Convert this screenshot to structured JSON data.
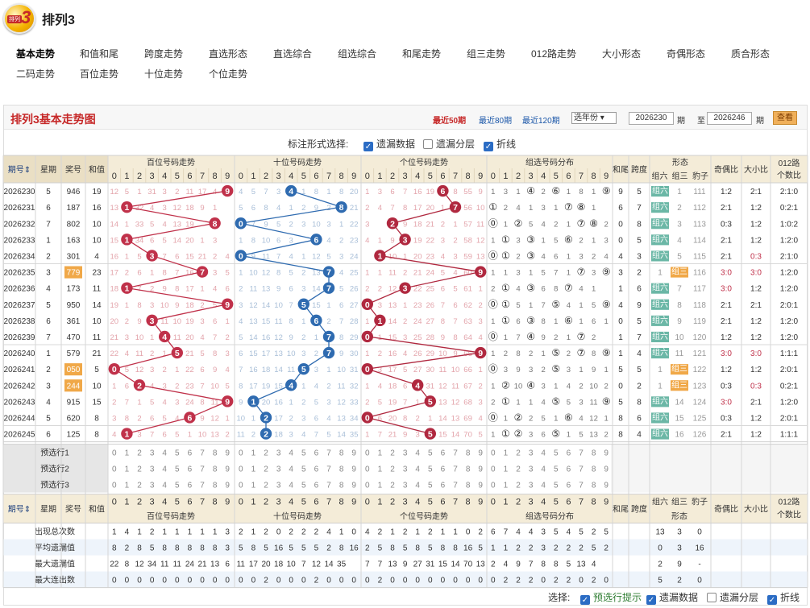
{
  "app": {
    "logo_text": "排列",
    "logo_num": "3",
    "title": "排列3"
  },
  "nav": [
    "基本走势",
    "和值和尾",
    "跨度走势",
    "直选形态",
    "直选综合",
    "组选综合",
    "和尾走势",
    "组三走势",
    "012路走势",
    "大小形态",
    "奇偶形态",
    "质合形态",
    "二码走势",
    "百位走势",
    "十位走势",
    "个位走势"
  ],
  "nav_active": 0,
  "panel": {
    "title": "排列3基本走势图",
    "recent50": "最近50期",
    "recent80": "最近80期",
    "recent120": "最近120期",
    "year_select": "选年份",
    "from": "2026230",
    "qi": "期",
    "to_label": "至",
    "to": "2026246",
    "qi2": "期",
    "view": "查看"
  },
  "options": {
    "label": "标注形式选择:",
    "o1": "遗漏数据",
    "o2": "遗漏分层",
    "o3": "折线"
  },
  "headers": {
    "issue": "期号",
    "week": "星期",
    "prize": "奖号",
    "sum": "和值",
    "g1": "百位号码走势",
    "g2": "十位号码走势",
    "g3": "个位号码走势",
    "g4": "组选号码分布",
    "hw": "和尾",
    "kd": "跨度",
    "xt": "形态",
    "z6": "组六",
    "z3": "组三",
    "bz": "豹子",
    "jo": "奇偶比",
    "dx": "大小比",
    "l012a": "012路",
    "l012b": "个数比"
  },
  "rows": [
    {
      "issue": "2026230",
      "week": "5",
      "prize": "946",
      "sum": "19",
      "hw": "9",
      "kd": "5",
      "form": "组六",
      "bz": "111",
      "jo": "1:2",
      "dx": "2:1",
      "l012": "2:1:0"
    },
    {
      "issue": "2026231",
      "week": "6",
      "prize": "187",
      "sum": "16",
      "hw": "6",
      "kd": "7",
      "form": "组六",
      "bz": "112",
      "jo": "2:1",
      "dx": "1:2",
      "l012": "0:2:1"
    },
    {
      "issue": "2026232",
      "week": "7",
      "prize": "802",
      "sum": "10",
      "hw": "0",
      "kd": "8",
      "form": "组六",
      "bz": "113",
      "jo": "0:3",
      "dx": "1:2",
      "l012": "1:0:2"
    },
    {
      "issue": "2026233",
      "week": "1",
      "prize": "163",
      "sum": "10",
      "hw": "0",
      "kd": "5",
      "form": "组六",
      "bz": "114",
      "jo": "2:1",
      "dx": "1:2",
      "l012": "1:2:0"
    },
    {
      "issue": "2026234",
      "week": "2",
      "prize": "301",
      "sum": "4",
      "hw": "4",
      "kd": "3",
      "form": "组六",
      "bz": "115",
      "jo": "2:1",
      "dx": "0:3",
      "l012": "2:1:0"
    },
    {
      "issue": "2026235",
      "week": "3",
      "prize": "779",
      "sum": "23",
      "hw": "3",
      "kd": "2",
      "form": "组三",
      "bz": "116",
      "jo": "3:0",
      "dx": "3:0",
      "l012": "1:2:0"
    },
    {
      "issue": "2026236",
      "week": "4",
      "prize": "173",
      "sum": "11",
      "hw": "1",
      "kd": "6",
      "form": "组六",
      "bz": "117",
      "jo": "3:0",
      "dx": "1:2",
      "l012": "1:2:0"
    },
    {
      "issue": "2026237",
      "week": "5",
      "prize": "950",
      "sum": "14",
      "hw": "4",
      "kd": "9",
      "form": "组六",
      "bz": "118",
      "jo": "2:1",
      "dx": "2:1",
      "l012": "2:0:1"
    },
    {
      "issue": "2026238",
      "week": "6",
      "prize": "361",
      "sum": "10",
      "hw": "0",
      "kd": "5",
      "form": "组六",
      "bz": "119",
      "jo": "2:1",
      "dx": "1:2",
      "l012": "1:2:0"
    },
    {
      "issue": "2026239",
      "week": "7",
      "prize": "470",
      "sum": "11",
      "hw": "1",
      "kd": "7",
      "form": "组六",
      "bz": "120",
      "jo": "1:2",
      "dx": "1:2",
      "l012": "1:2:0"
    },
    {
      "issue": "2026240",
      "week": "1",
      "prize": "579",
      "sum": "21",
      "hw": "1",
      "kd": "4",
      "form": "组六",
      "bz": "121",
      "jo": "3:0",
      "dx": "3:0",
      "l012": "1:1:1"
    },
    {
      "issue": "2026241",
      "week": "2",
      "prize": "050",
      "sum": "5",
      "hw": "5",
      "kd": "5",
      "form": "组三",
      "bz": "122",
      "jo": "1:2",
      "dx": "1:2",
      "l012": "2:0:1"
    },
    {
      "issue": "2026242",
      "week": "3",
      "prize": "244",
      "sum": "10",
      "hw": "0",
      "kd": "2",
      "form": "组三",
      "bz": "123",
      "jo": "0:3",
      "dx": "0:3",
      "l012": "0:2:1"
    },
    {
      "issue": "2026243",
      "week": "4",
      "prize": "915",
      "sum": "15",
      "hw": "5",
      "kd": "8",
      "form": "组六",
      "bz": "124",
      "jo": "3:0",
      "dx": "2:1",
      "l012": "1:2:0"
    },
    {
      "issue": "2026244",
      "week": "5",
      "prize": "620",
      "sum": "8",
      "hw": "8",
      "kd": "6",
      "form": "组六",
      "bz": "125",
      "jo": "0:3",
      "dx": "1:2",
      "l012": "2:0:1"
    },
    {
      "issue": "2026245",
      "week": "6",
      "prize": "125",
      "sum": "8",
      "hw": "8",
      "kd": "4",
      "form": "组六",
      "bz": "126",
      "jo": "2:1",
      "dx": "1:2",
      "l012": "1:1:1"
    }
  ],
  "miss": {
    "b": [
      [
        12,
        5,
        1,
        31,
        3,
        2,
        11,
        17,
        4,
        null
      ],
      [
        13,
        null,
        32,
        4,
        3,
        12,
        18,
        9,
        1,
        null
      ],
      [
        14,
        1,
        33,
        5,
        4,
        13,
        19,
        null,
        2,
        null
      ],
      [
        15,
        null,
        34,
        6,
        5,
        14,
        20,
        1,
        3,
        null
      ],
      [
        16,
        1,
        5,
        null,
        7,
        6,
        15,
        21,
        2,
        4
      ],
      [
        17,
        2,
        6,
        1,
        8,
        7,
        16,
        null,
        3,
        5
      ],
      [
        18,
        null,
        7,
        2,
        9,
        8,
        17,
        1,
        4,
        6
      ],
      [
        19,
        1,
        8,
        3,
        10,
        9,
        18,
        2,
        5,
        null
      ],
      [
        20,
        2,
        9,
        null,
        11,
        10,
        19,
        3,
        6,
        1
      ],
      [
        21,
        3,
        10,
        1,
        null,
        11,
        20,
        4,
        7,
        2
      ],
      [
        22,
        4,
        11,
        2,
        1,
        null,
        21,
        5,
        8,
        3
      ],
      [
        null,
        5,
        12,
        3,
        2,
        1,
        22,
        6,
        9,
        4
      ],
      [
        1,
        6,
        null,
        4,
        3,
        2,
        23,
        7,
        10,
        5
      ],
      [
        2,
        7,
        1,
        5,
        4,
        3,
        24,
        8,
        11,
        null
      ],
      [
        3,
        8,
        2,
        6,
        5,
        4,
        null,
        9,
        12,
        1
      ],
      [
        4,
        null,
        3,
        7,
        6,
        5,
        1,
        10,
        13,
        2
      ]
    ],
    "s": [
      [
        4,
        5,
        7,
        3,
        null,
        1,
        8,
        1,
        8,
        20
      ],
      [
        5,
        6,
        8,
        4,
        1,
        2,
        9,
        2,
        null,
        21
      ],
      [
        null,
        7,
        9,
        5,
        2,
        3,
        10,
        3,
        1,
        22
      ],
      [
        1,
        8,
        10,
        6,
        3,
        null,
        11,
        4,
        2,
        23
      ],
      [
        null,
        9,
        11,
        7,
        4,
        1,
        12,
        5,
        3,
        24
      ],
      [
        1,
        10,
        12,
        8,
        5,
        2,
        13,
        null,
        4,
        25
      ],
      [
        2,
        11,
        13,
        9,
        6,
        3,
        14,
        null,
        5,
        26
      ],
      [
        3,
        12,
        14,
        10,
        7,
        null,
        15,
        1,
        6,
        27
      ],
      [
        4,
        13,
        15,
        11,
        8,
        1,
        null,
        2,
        7,
        28
      ],
      [
        5,
        14,
        16,
        12,
        9,
        2,
        1,
        null,
        8,
        29
      ],
      [
        6,
        15,
        17,
        13,
        10,
        3,
        2,
        null,
        9,
        30
      ],
      [
        7,
        16,
        18,
        14,
        11,
        null,
        3,
        1,
        10,
        31
      ],
      [
        8,
        17,
        19,
        15,
        null,
        1,
        4,
        2,
        11,
        32
      ],
      [
        9,
        null,
        20,
        16,
        1,
        2,
        5,
        3,
        12,
        33
      ],
      [
        10,
        1,
        null,
        17,
        2,
        3,
        6,
        4,
        13,
        34
      ],
      [
        11,
        2,
        null,
        18,
        3,
        4,
        7,
        5,
        14,
        35
      ]
    ],
    "g": [
      [
        1,
        3,
        6,
        7,
        16,
        19,
        null,
        8,
        55,
        9
      ],
      [
        2,
        4,
        7,
        8,
        17,
        20,
        1,
        null,
        56,
        10
      ],
      [
        3,
        null,
        8,
        9,
        18,
        21,
        2,
        1,
        57,
        11
      ],
      [
        4,
        1,
        9,
        null,
        19,
        22,
        3,
        2,
        58,
        12
      ],
      [
        null,
        null,
        10,
        1,
        20,
        23,
        4,
        3,
        59,
        13
      ],
      [
        1,
        1,
        11,
        2,
        21,
        24,
        5,
        4,
        60,
        null
      ],
      [
        2,
        2,
        12,
        null,
        22,
        25,
        6,
        5,
        61,
        1
      ],
      [
        null,
        3,
        13,
        1,
        23,
        26,
        7,
        6,
        62,
        2
      ],
      [
        1,
        null,
        14,
        2,
        24,
        27,
        8,
        7,
        63,
        3
      ],
      [
        null,
        1,
        15,
        3,
        25,
        28,
        9,
        8,
        64,
        4
      ],
      [
        1,
        2,
        16,
        4,
        26,
        29,
        10,
        9,
        65,
        null
      ],
      [
        null,
        3,
        17,
        5,
        27,
        30,
        11,
        10,
        66,
        1
      ],
      [
        1,
        4,
        18,
        6,
        null,
        31,
        12,
        11,
        67,
        2
      ],
      [
        2,
        5,
        19,
        7,
        1,
        null,
        13,
        12,
        68,
        3
      ],
      [
        null,
        6,
        20,
        8,
        2,
        1,
        14,
        13,
        69,
        4
      ],
      [
        1,
        7,
        21,
        9,
        3,
        null,
        15,
        14,
        70,
        5
      ]
    ],
    "z": [
      [
        1,
        3,
        1,
        "④",
        2,
        "⑥",
        1,
        8,
        1,
        "⑨"
      ],
      [
        "①",
        2,
        4,
        1,
        3,
        1,
        "⑦",
        "⑧",
        1
      ],
      [
        "⓪",
        1,
        "②",
        5,
        4,
        2,
        1,
        "⑦",
        "⑧",
        2
      ],
      [
        1,
        "①",
        3,
        "③",
        1,
        5,
        "⑥",
        2,
        1,
        3
      ],
      [
        "⓪",
        "①",
        2,
        "③",
        4,
        6,
        1,
        3,
        2,
        4
      ],
      [
        1,
        1,
        3,
        1,
        5,
        7,
        1,
        "⑦",
        3,
        "⑨"
      ],
      [
        2,
        "①",
        4,
        "③",
        6,
        8,
        "⑦",
        4,
        1
      ],
      [
        "⓪",
        "①",
        5,
        1,
        7,
        "⑤",
        4,
        1,
        5,
        "⑨"
      ],
      [
        1,
        "①",
        6,
        "③",
        8,
        1,
        "⑥",
        1,
        6,
        1
      ],
      [
        "⓪",
        1,
        7,
        "④",
        9,
        2,
        1,
        "⑦",
        2
      ],
      [
        1,
        2,
        8,
        2,
        1,
        "⑤",
        2,
        "⑦",
        8,
        "⑨"
      ],
      [
        "⓪",
        3,
        9,
        3,
        2,
        "⑤",
        3,
        1,
        9,
        1
      ],
      [
        1,
        "②",
        10,
        "④",
        3,
        1,
        4,
        2,
        10,
        2
      ],
      [
        2,
        "①",
        1,
        1,
        4,
        "⑤",
        5,
        3,
        11,
        "⑨"
      ],
      [
        "⓪",
        1,
        "②",
        2,
        5,
        1,
        "⑥",
        4,
        12,
        1
      ],
      [
        1,
        "①",
        "②",
        3,
        6,
        "⑤",
        1,
        5,
        13,
        2
      ]
    ]
  },
  "pre": [
    "预选行1",
    "预选行2",
    "预选行3"
  ],
  "digits": [
    "0",
    "1",
    "2",
    "3",
    "4",
    "5",
    "6",
    "7",
    "8",
    "9"
  ],
  "stats": [
    {
      "label": "出现总次数",
      "b": [
        1,
        4,
        1,
        2,
        1,
        1,
        1,
        1,
        1,
        3
      ],
      "s": [
        2,
        1,
        2,
        0,
        2,
        2,
        2,
        4,
        1,
        0
      ],
      "g": [
        4,
        2,
        1,
        2,
        1,
        2,
        1,
        1,
        0,
        2
      ],
      "z": [
        6,
        7,
        4,
        4,
        3,
        5,
        4,
        5,
        2,
        5
      ],
      "xt": [
        "13",
        "3",
        "0"
      ]
    },
    {
      "label": "平均遗漏值",
      "b": [
        8,
        2,
        8,
        5,
        8,
        8,
        8,
        8,
        8,
        3
      ],
      "s": [
        5,
        8,
        5,
        16,
        5,
        5,
        5,
        2,
        8,
        16
      ],
      "g": [
        2,
        5,
        8,
        5,
        8,
        5,
        8,
        8,
        16,
        5
      ],
      "z": [
        1,
        1,
        2,
        2,
        3,
        2,
        2,
        2,
        5,
        2
      ],
      "xt": [
        "0",
        "3",
        "16"
      ]
    },
    {
      "label": "最大遗漏值",
      "b": [
        22,
        8,
        12,
        34,
        11,
        11,
        24,
        21,
        13,
        6
      ],
      "s": [
        11,
        17,
        20,
        18,
        10,
        7,
        12,
        14,
        35,
        ""
      ],
      "g": [
        7,
        7,
        13,
        9,
        27,
        31,
        15,
        14,
        70,
        13
      ],
      "z": [
        2,
        4,
        9,
        7,
        8,
        8,
        5,
        13,
        4,
        ""
      ],
      "xt": [
        "2",
        "9",
        "-"
      ]
    },
    {
      "label": "最大连出数",
      "b": [
        0,
        0,
        0,
        0,
        0,
        0,
        0,
        0,
        0,
        0
      ],
      "s": [
        0,
        0,
        2,
        0,
        0,
        0,
        2,
        0,
        0,
        0
      ],
      "g": [
        0,
        2,
        0,
        0,
        0,
        0,
        0,
        0,
        0,
        0
      ],
      "z": [
        0,
        2,
        2,
        2,
        0,
        2,
        2,
        0,
        2,
        0
      ],
      "xt": [
        "5",
        "2",
        "0"
      ]
    }
  ],
  "bottom": {
    "label": "选择:",
    "o1": "预选行提示",
    "o2": "遗漏数据",
    "o3": "遗漏分层",
    "o4": "折线"
  }
}
